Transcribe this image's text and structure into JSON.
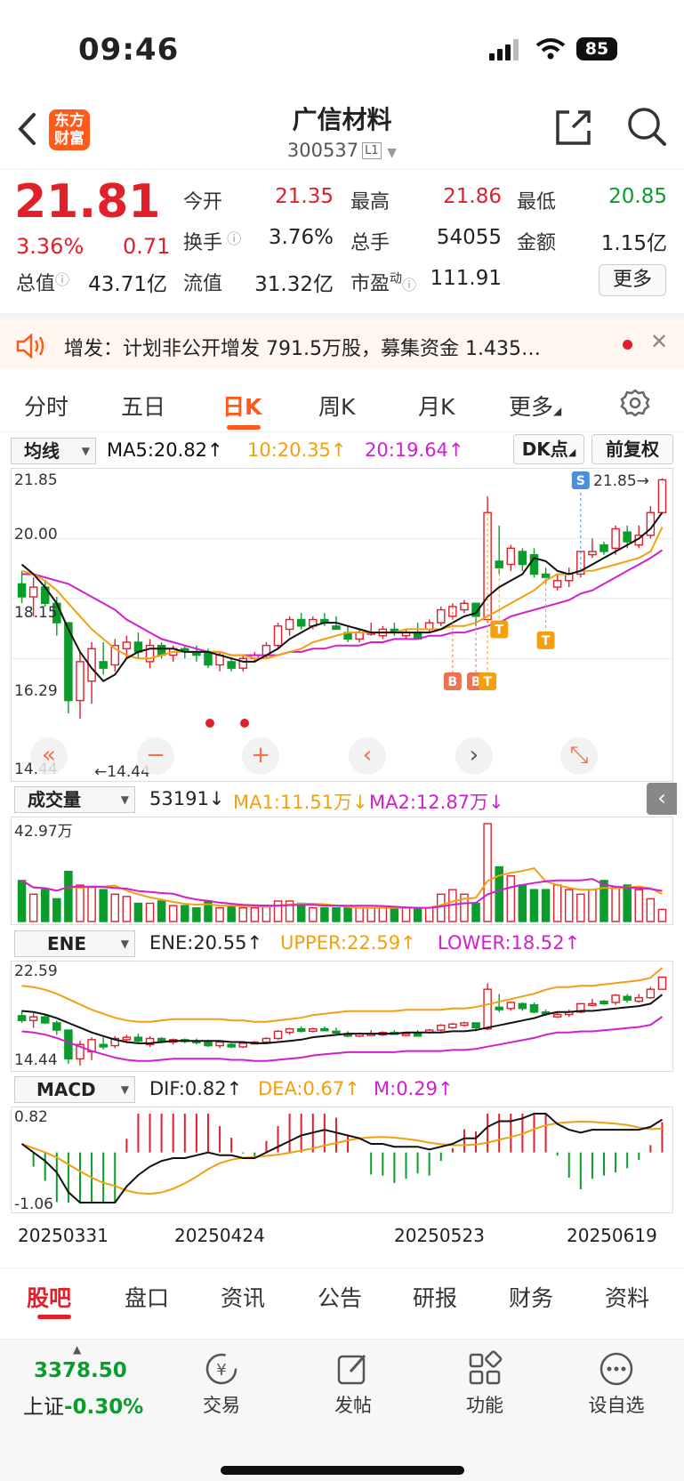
{
  "status": {
    "time": "09:46",
    "battery": "85"
  },
  "header": {
    "name": "广信材料",
    "code": "300537",
    "level": "L1",
    "logo_line1": "东方",
    "logo_line2": "财富"
  },
  "quote": {
    "price": "21.81",
    "change_pct": "3.36%",
    "change": "0.71",
    "open_label": "今开",
    "open": "21.35",
    "high_label": "最高",
    "high": "21.86",
    "low_label": "最低",
    "low": "20.85",
    "turnover_label": "换手",
    "turnover": "3.76%",
    "volume_label": "总手",
    "volume": "54055",
    "amount_label": "金额",
    "amount": "1.15亿",
    "mktcap_label": "总值",
    "mktcap": "43.71亿",
    "float_label": "流值",
    "float": "31.32亿",
    "pe_label": "市盈",
    "pe_sup": "动",
    "pe": "111.91",
    "more": "更多"
  },
  "notice": {
    "text": "增发：计划非公开增发 791.5万股，募集资金 1.435…"
  },
  "period_tabs": [
    "分时",
    "五日",
    "日K",
    "周K",
    "月K",
    "更多"
  ],
  "kline": {
    "selector": "均线",
    "ma5": "MA5:20.82↑",
    "ma10": "10:20.35↑",
    "ma20": "20:19.64↑",
    "dk_button": "DK点",
    "fq_button": "前复权",
    "price_labels": [
      "21.85",
      "20.00",
      "18.15",
      "16.29",
      "14.44"
    ],
    "max_marker": "21.85→",
    "min_marker": "←14.44",
    "signals": [
      "B",
      "B",
      "T",
      "T",
      "T",
      "S"
    ]
  },
  "volume": {
    "selector": "成交量",
    "value": "53191↓",
    "ma1": "MA1:11.51万↓",
    "ma2": "MA2:12.87万↓",
    "max_label": "42.97万"
  },
  "ene": {
    "selector": "ENE",
    "ene": "ENE:20.55↑",
    "upper": "UPPER:22.59↑",
    "lower": "LOWER:18.52↑",
    "top": "22.59",
    "bottom": "14.44"
  },
  "macd": {
    "selector": "MACD",
    "dif": "DIF:0.82↑",
    "dea": "DEA:0.67↑",
    "m": "M:0.29↑",
    "top": "0.82",
    "bottom": "-1.06"
  },
  "dates": [
    "20250331",
    "20250424",
    "20250523",
    "20250619"
  ],
  "bottom_tabs": [
    "股吧",
    "盘口",
    "资讯",
    "公告",
    "研报",
    "财务",
    "资料"
  ],
  "dock": {
    "index_value": "3378.50",
    "index_name": "上证",
    "index_change": "-0.30%",
    "items": [
      "交易",
      "发帖",
      "功能",
      "设自选"
    ]
  },
  "colors": {
    "up": "#e0202b",
    "down": "#0a9d2c",
    "accent": "#ff5a1a",
    "ma5": "#111111",
    "ma10": "#f2a010",
    "ma20": "#d11fcf"
  },
  "chart_data": {
    "type": "candlestick",
    "x": [
      "20250331",
      "20250424",
      "20250523",
      "20250619"
    ],
    "ylim": [
      14.44,
      21.85
    ],
    "candles": [
      [
        18.6,
        19.0,
        18.0,
        18.2
      ],
      [
        18.2,
        18.8,
        17.6,
        18.5
      ],
      [
        18.5,
        18.7,
        17.9,
        18.0
      ],
      [
        18.0,
        18.2,
        17.0,
        17.4
      ],
      [
        17.4,
        17.4,
        14.6,
        15.0
      ],
      [
        15.0,
        16.5,
        14.44,
        16.2
      ],
      [
        15.6,
        16.8,
        14.9,
        16.6
      ],
      [
        16.2,
        16.8,
        15.8,
        16.0
      ],
      [
        16.1,
        16.9,
        15.9,
        16.7
      ],
      [
        16.6,
        17.0,
        16.3,
        16.8
      ],
      [
        16.8,
        17.1,
        16.3,
        16.5
      ],
      [
        16.2,
        16.9,
        16.0,
        16.7
      ],
      [
        16.7,
        16.8,
        16.3,
        16.4
      ],
      [
        16.4,
        16.7,
        16.2,
        16.6
      ],
      [
        16.6,
        16.7,
        16.3,
        16.5
      ],
      [
        16.5,
        16.7,
        16.2,
        16.4
      ],
      [
        16.5,
        16.6,
        16.0,
        16.1
      ],
      [
        16.1,
        16.5,
        15.9,
        16.4
      ],
      [
        16.2,
        16.3,
        15.9,
        16.0
      ],
      [
        16.0,
        16.4,
        15.9,
        16.3
      ],
      [
        16.3,
        16.5,
        16.2,
        16.4
      ],
      [
        16.4,
        16.8,
        16.3,
        16.7
      ],
      [
        16.7,
        17.4,
        16.6,
        17.3
      ],
      [
        17.2,
        17.6,
        17.0,
        17.5
      ],
      [
        17.5,
        17.7,
        17.2,
        17.3
      ],
      [
        17.3,
        17.6,
        17.2,
        17.5
      ],
      [
        17.5,
        17.7,
        17.3,
        17.4
      ],
      [
        17.3,
        17.6,
        17.2,
        17.2
      ],
      [
        17.1,
        17.3,
        16.8,
        16.9
      ],
      [
        16.9,
        17.2,
        16.8,
        17.1
      ],
      [
        17.1,
        17.4,
        17.0,
        17.1
      ],
      [
        17.0,
        17.3,
        16.9,
        17.2
      ],
      [
        17.2,
        17.4,
        17.0,
        17.1
      ],
      [
        17.0,
        17.2,
        16.9,
        17.1
      ],
      [
        17.1,
        17.4,
        16.9,
        16.9
      ],
      [
        17.2,
        17.5,
        17.1,
        17.4
      ],
      [
        17.4,
        17.9,
        17.3,
        17.8
      ],
      [
        17.6,
        18.0,
        17.5,
        17.9
      ],
      [
        17.8,
        18.1,
        17.7,
        18.0
      ],
      [
        18.0,
        17.9,
        17.3,
        17.6
      ],
      [
        17.5,
        21.3,
        17.4,
        20.8
      ],
      [
        19.3,
        20.4,
        18.9,
        19.1
      ],
      [
        19.2,
        19.8,
        19.0,
        19.7
      ],
      [
        19.6,
        19.7,
        19.0,
        19.2
      ],
      [
        19.5,
        19.7,
        18.8,
        18.9
      ],
      [
        18.9,
        19.1,
        18.6,
        18.8
      ],
      [
        18.5,
        18.9,
        18.4,
        18.7
      ],
      [
        18.7,
        19.1,
        18.5,
        18.9
      ],
      [
        18.9,
        19.6,
        18.8,
        19.6
      ],
      [
        19.5,
        20.0,
        19.4,
        19.6
      ],
      [
        19.8,
        19.9,
        19.5,
        19.6
      ],
      [
        19.7,
        20.4,
        19.5,
        20.3
      ],
      [
        20.2,
        20.4,
        19.7,
        19.9
      ],
      [
        19.8,
        20.4,
        19.7,
        20.1
      ],
      [
        20.1,
        21.0,
        20.0,
        20.8
      ],
      [
        20.8,
        21.86,
        20.85,
        21.81
      ]
    ],
    "ma5": [
      19.2,
      18.9,
      18.5,
      18.0,
      17.2,
      16.5,
      16.0,
      15.6,
      15.8,
      16.3,
      16.5,
      16.6,
      16.6,
      16.6,
      16.5,
      16.5,
      16.5,
      16.4,
      16.3,
      16.2,
      16.2,
      16.4,
      16.6,
      16.9,
      17.1,
      17.3,
      17.4,
      17.4,
      17.3,
      17.2,
      17.1,
      17.1,
      17.1,
      17.1,
      17.1,
      17.1,
      17.2,
      17.4,
      17.6,
      17.7,
      18.2,
      18.5,
      18.7,
      18.9,
      19.4,
      19.3,
      19.0,
      18.9,
      19.0,
      19.2,
      19.4,
      19.6,
      19.8,
      20.0,
      20.3,
      20.8
    ],
    "ma10": [
      19.0,
      18.9,
      18.7,
      18.4,
      18.0,
      17.6,
      17.2,
      16.9,
      16.6,
      16.4,
      16.3,
      16.3,
      16.4,
      16.5,
      16.5,
      16.5,
      16.5,
      16.5,
      16.4,
      16.4,
      16.3,
      16.3,
      16.4,
      16.5,
      16.6,
      16.8,
      16.9,
      17.0,
      17.1,
      17.1,
      17.1,
      17.1,
      17.1,
      17.2,
      17.2,
      17.2,
      17.2,
      17.3,
      17.3,
      17.4,
      17.6,
      17.8,
      18.0,
      18.2,
      18.4,
      18.7,
      18.9,
      18.9,
      19.0,
      19.0,
      19.1,
      19.2,
      19.3,
      19.4,
      19.6,
      20.35
    ],
    "ma20": [
      18.9,
      18.9,
      18.8,
      18.7,
      18.6,
      18.4,
      18.2,
      18.0,
      17.8,
      17.5,
      17.3,
      17.1,
      16.9,
      16.8,
      16.7,
      16.6,
      16.5,
      16.5,
      16.4,
      16.4,
      16.4,
      16.4,
      16.4,
      16.5,
      16.5,
      16.6,
      16.6,
      16.7,
      16.7,
      16.7,
      16.8,
      16.8,
      16.9,
      16.9,
      16.9,
      17.0,
      17.0,
      17.1,
      17.1,
      17.2,
      17.3,
      17.4,
      17.6,
      17.7,
      17.8,
      17.9,
      18.0,
      18.1,
      18.3,
      18.4,
      18.6,
      18.8,
      19.0,
      19.2,
      19.4,
      19.64
    ],
    "volume": [
      18,
      12,
      14,
      10,
      22,
      16,
      15,
      14,
      12,
      11,
      8,
      8,
      9,
      7,
      7,
      6,
      9,
      6,
      7,
      6,
      6,
      7,
      9,
      9,
      8,
      6,
      6,
      6,
      6,
      6,
      6,
      6,
      6,
      6,
      6,
      6,
      12,
      14,
      12,
      8,
      42.97,
      24,
      20,
      16,
      14,
      14,
      16,
      14,
      12,
      14,
      18,
      15,
      16,
      14,
      10,
      5.3
    ],
    "volume_max": 42.97
  }
}
